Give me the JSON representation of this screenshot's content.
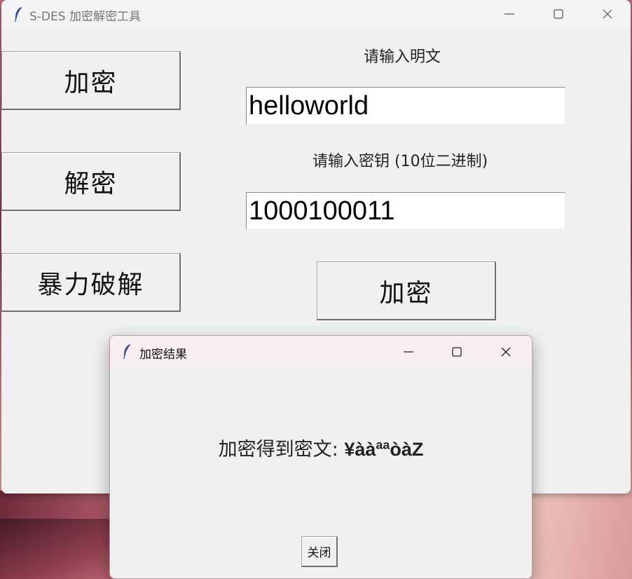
{
  "main_window": {
    "title": "S-DES 加密解密工具",
    "controls": {
      "minimize_icon": "minimize-icon",
      "maximize_icon": "maximize-icon",
      "close_icon": "close-icon"
    }
  },
  "sidebar": {
    "buttons": [
      {
        "label": "加密"
      },
      {
        "label": "解密"
      },
      {
        "label": "暴力破解"
      }
    ]
  },
  "form": {
    "plaintext_label": "请输入明文",
    "plaintext_value": "helloworld",
    "key_label": "请输入密钥 (10位二进制)",
    "key_value": "1000100011",
    "submit_label": "加密"
  },
  "dialog": {
    "title": "加密结果",
    "result_prefix": "加密得到密文: ",
    "result_value": "¥ààªªòàZ",
    "close_label": "关闭"
  }
}
